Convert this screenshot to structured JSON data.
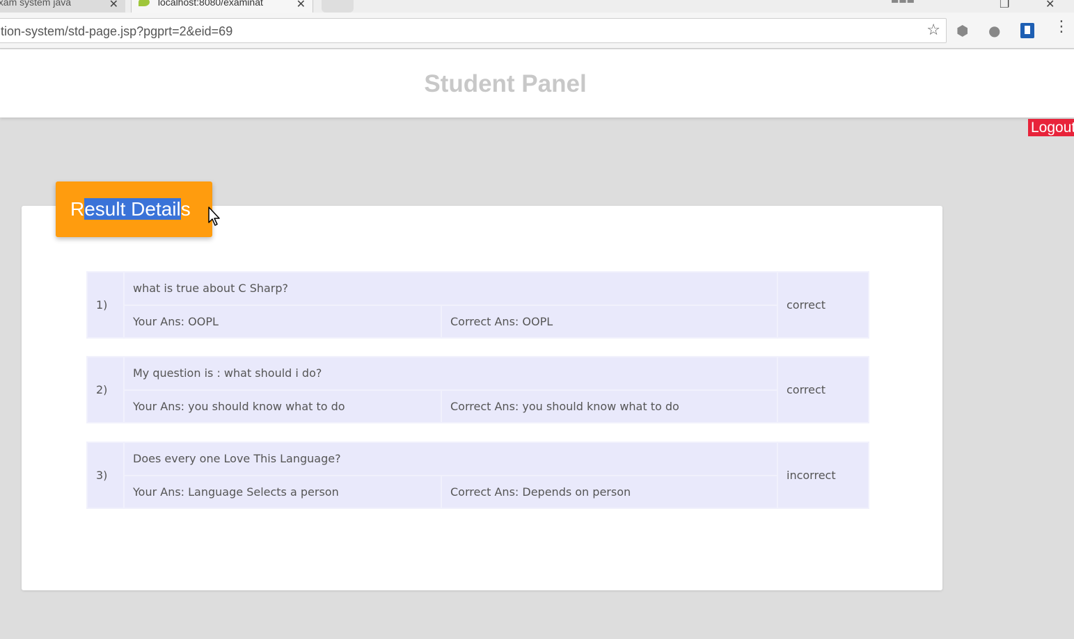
{
  "browser": {
    "tabs": [
      {
        "title": "exam system java"
      },
      {
        "title": "localhost:8080/examinat"
      }
    ],
    "url": "tion-system/std-page.jsp?pgprt=2&eid=69"
  },
  "header": {
    "title": "Student Panel"
  },
  "logout_label": "Logout",
  "result_heading": {
    "first_letter": "R",
    "selected_text": "esult Detail",
    "last_letter": "s"
  },
  "results": [
    {
      "number": "1)",
      "question": "what is true about C Sharp?",
      "your_ans": "Your Ans: OOPL",
      "correct_ans": "Correct Ans: OOPL",
      "status": "correct"
    },
    {
      "number": "2)",
      "question": "My question is : what should i do?",
      "your_ans": "Your Ans: you should know what to do",
      "correct_ans": "Correct Ans: you should know what to do",
      "status": "correct"
    },
    {
      "number": "3)",
      "question": "Does every one Love This Language?",
      "your_ans": "Your Ans: Language Selects a person",
      "correct_ans": "Correct Ans: Depends on person",
      "status": "incorrect"
    }
  ],
  "colors": {
    "accent": "#ff9c0e",
    "logout": "#e8233a",
    "table_bg": "#e9e9fb",
    "selection": "#3a73d8"
  }
}
